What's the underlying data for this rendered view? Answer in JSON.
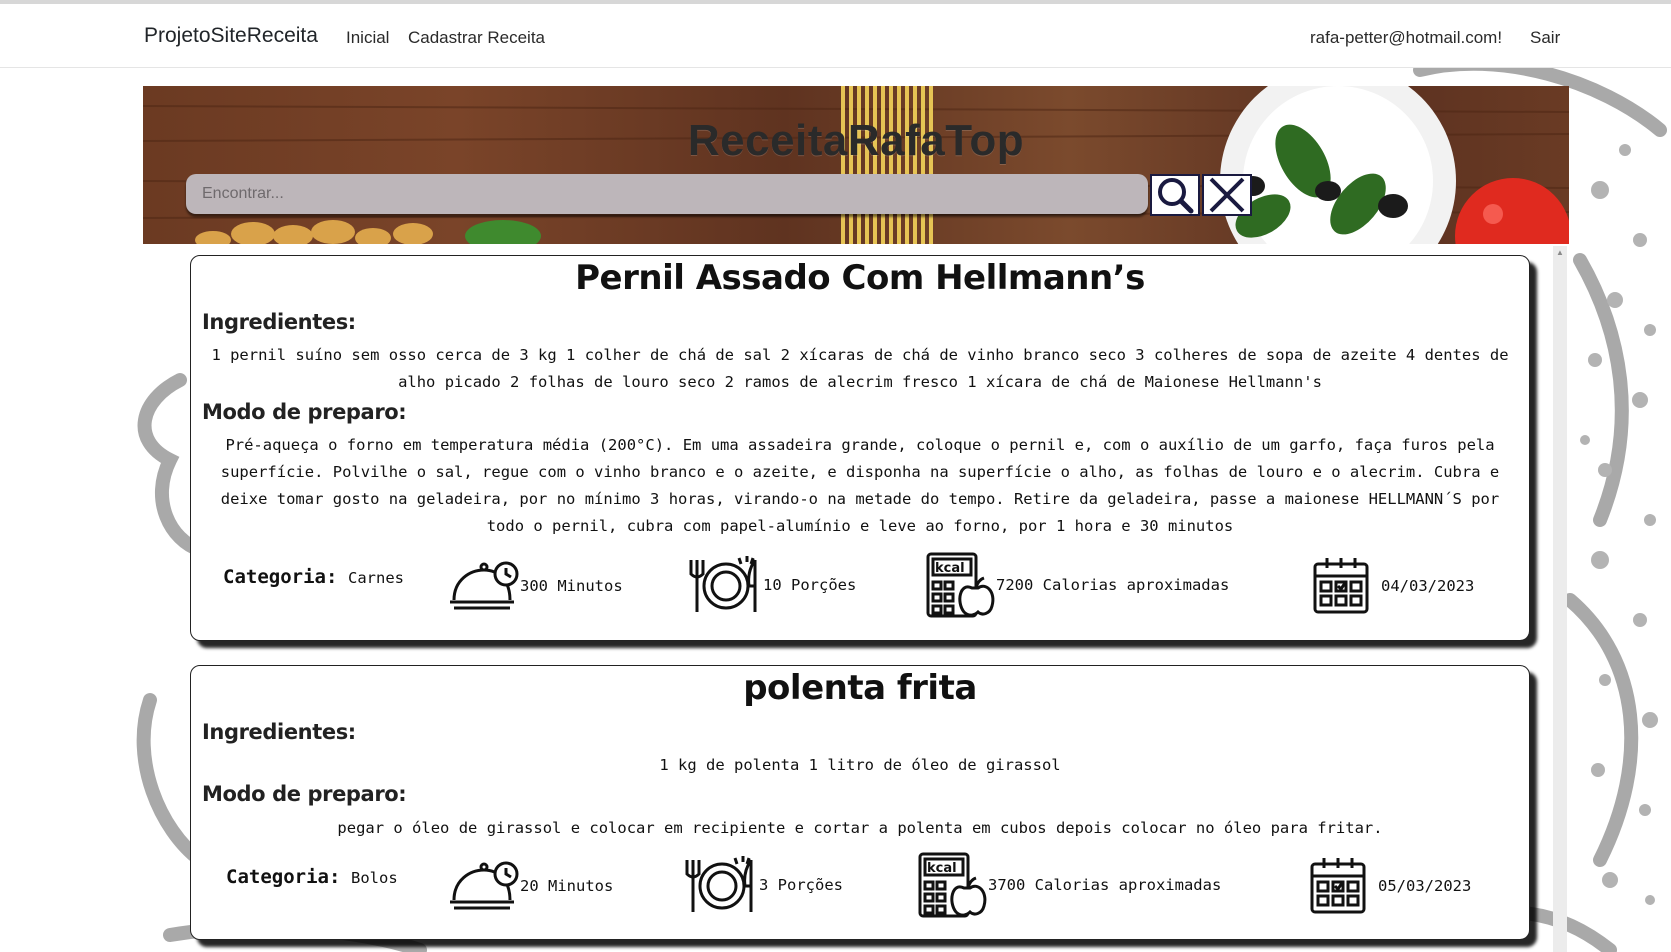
{
  "navbar": {
    "brand": "ProjetoSiteReceita",
    "links": [
      "Inicial",
      "Cadastrar Receita"
    ],
    "user_email": "rafa-petter@hotmail.com!",
    "logout": "Sair"
  },
  "banner": {
    "title": "ReceitaRafaTop",
    "search_placeholder": "Encontrar..."
  },
  "labels": {
    "ingredients": "Ingredientes:",
    "preparation": "Modo de preparo:",
    "category": "Categoria:"
  },
  "recipes": [
    {
      "title": "Pernil Assado Com Hellmann’s",
      "ingredients": "1 pernil suíno sem osso cerca de 3 kg 1 colher de chá de sal 2 xícaras de chá de vinho branco seco 3 colheres de sopa de azeite 4 dentes de alho picado 2 folhas de louro seco 2 ramos de alecrim fresco 1 xícara de chá de Maionese Hellmann's",
      "preparation": "Pré-aqueça o forno em temperatura média (200°C). Em uma assadeira grande, coloque o pernil e, com o auxílio de um garfo, faça furos pela superfície. Polvilhe o sal, regue com o vinho branco e o azeite, e disponha na superfície o alho, as folhas de louro e o alecrim. Cubra e deixe tomar gosto na geladeira, por no mínimo 3 horas, virando-o na metade do tempo. Retire da geladeira, passe a maionese HELLMANN´S por todo o pernil, cubra com papel-alumínio e leve ao forno, por 1 hora e 30 minutos",
      "category": "Carnes",
      "time": "300 Minutos",
      "servings": "10 Porções",
      "calories": "7200 Calorias aproximadas",
      "date": "04/03/2023"
    },
    {
      "title": "polenta frita",
      "ingredients": "1 kg de polenta 1 litro de óleo de girassol",
      "preparation": "pegar o óleo de girassol e colocar em recipiente e cortar a polenta em cubos depois colocar no óleo para fritar.",
      "category": "Bolos",
      "time": "20 Minutos",
      "servings": "3 Porções",
      "calories": "3700 Calorias aproximadas",
      "date": "05/03/2023"
    }
  ],
  "icons": {
    "search": "search-icon",
    "clear": "close-icon",
    "time": "cloche-clock-icon",
    "servings": "plate-cutlery-icon",
    "calories": "kcal-calculator-icon",
    "date": "calendar-icon",
    "kcal_text": "kcal"
  },
  "colors": {
    "search_bg": "#bdb6ba",
    "banner_wood": "#6b3a22",
    "card_shadow": "#000000"
  }
}
